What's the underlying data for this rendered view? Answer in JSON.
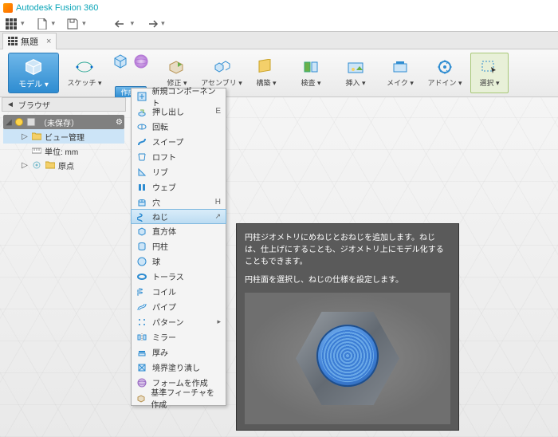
{
  "window": {
    "title": "Autodesk Fusion 360"
  },
  "tabs": {
    "active": "無題"
  },
  "ribbon": {
    "model": "モデル",
    "sketch": "スケッチ",
    "create": "作成",
    "modify": "修正",
    "assembly": "アセンブリ",
    "construct": "構築",
    "inspect": "検査",
    "insert": "挿入",
    "make": "メイク",
    "addin": "アドイン",
    "select": "選択"
  },
  "browser": {
    "header": "ブラウザ",
    "root": "（未保存）",
    "view": "ビュー管理",
    "units": "単位: mm",
    "origin": "原点"
  },
  "dropdown": {
    "items": [
      {
        "label": "新規コンポーネント",
        "icon": "new-component-icon"
      },
      {
        "label": "押し出し",
        "icon": "extrude-icon",
        "shortcut": "E"
      },
      {
        "label": "回転",
        "icon": "revolve-icon"
      },
      {
        "label": "スイープ",
        "icon": "sweep-icon"
      },
      {
        "label": "ロフト",
        "icon": "loft-icon"
      },
      {
        "label": "リブ",
        "icon": "rib-icon"
      },
      {
        "label": "ウェブ",
        "icon": "web-icon"
      },
      {
        "label": "穴",
        "icon": "hole-icon",
        "shortcut": "H"
      },
      {
        "label": "ねじ",
        "icon": "thread-icon",
        "selected": true
      },
      {
        "label": "直方体",
        "icon": "box-icon"
      },
      {
        "label": "円柱",
        "icon": "cylinder-icon"
      },
      {
        "label": "球",
        "icon": "sphere-icon"
      },
      {
        "label": "トーラス",
        "icon": "torus-icon"
      },
      {
        "label": "コイル",
        "icon": "coil-icon"
      },
      {
        "label": "パイプ",
        "icon": "pipe-icon"
      },
      {
        "label": "パターン",
        "icon": "pattern-icon",
        "submenu": true
      },
      {
        "label": "ミラー",
        "icon": "mirror-icon"
      },
      {
        "label": "厚み",
        "icon": "thicken-icon"
      },
      {
        "label": "境界塗り潰し",
        "icon": "boundary-fill-icon"
      },
      {
        "label": "フォームを作成",
        "icon": "create-form-icon"
      },
      {
        "label": "基準フィーチャを作成",
        "icon": "base-feature-icon"
      }
    ]
  },
  "tooltip": {
    "desc": "円柱ジオメトリにめねじとおねじを追加します。ねじは、仕上げにすることも、ジオメトリ上にモデル化することもできます。",
    "hint": "円柱面を選択し、ねじの仕様を設定します。"
  }
}
